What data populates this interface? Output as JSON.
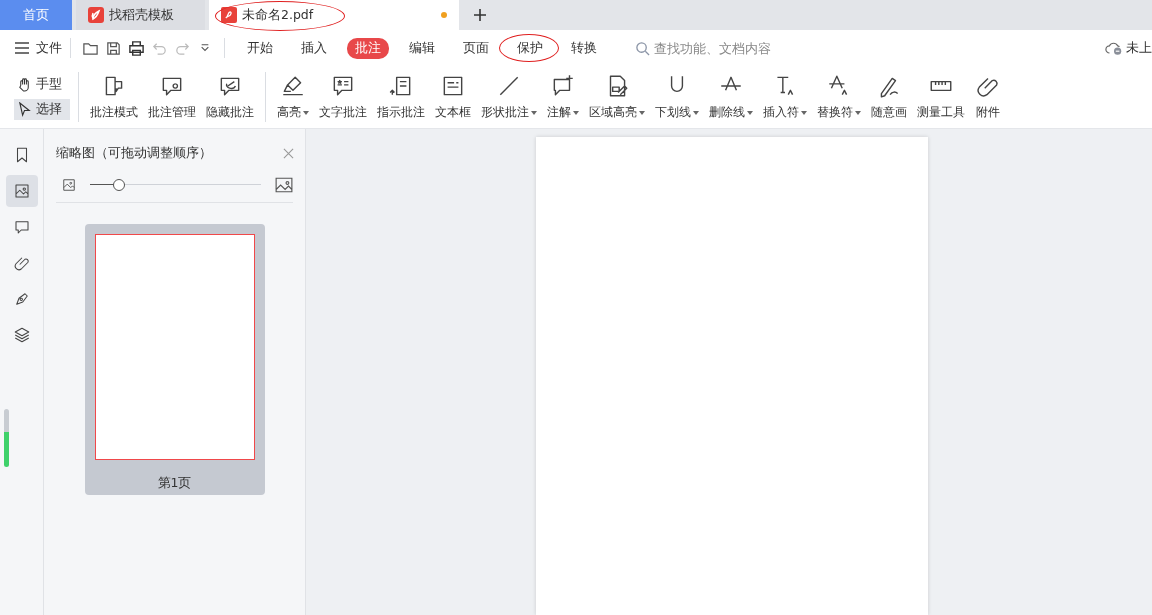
{
  "tabs": [
    {
      "label": "首页",
      "selected": false,
      "kind": "home"
    },
    {
      "label": "找稻壳模板",
      "selected": false,
      "kind": "template"
    },
    {
      "label": "未命名2.pdf",
      "selected": true,
      "kind": "pdf",
      "unsaved": true,
      "circled": true
    }
  ],
  "menu": {
    "label": "文件",
    "items": [
      {
        "label": "开始",
        "selected": false,
        "circled": false
      },
      {
        "label": "插入",
        "selected": false,
        "circled": false
      },
      {
        "label": "批注",
        "selected": true,
        "circled": false
      },
      {
        "label": "编辑",
        "selected": false,
        "circled": false
      },
      {
        "label": "页面",
        "selected": false,
        "circled": false
      },
      {
        "label": "保护",
        "selected": false,
        "circled": true
      },
      {
        "label": "转换",
        "selected": false,
        "circled": false
      }
    ]
  },
  "search": {
    "placeholder": "查找功能、文档内容"
  },
  "cloud_status": "未上",
  "modes": [
    {
      "label": "手型",
      "selected": false
    },
    {
      "label": "选择",
      "selected": true
    }
  ],
  "tool_groups": [
    [
      {
        "label": "批注模式",
        "dropdown": false
      },
      {
        "label": "批注管理",
        "dropdown": false
      },
      {
        "label": "隐藏批注",
        "dropdown": false
      }
    ],
    [
      {
        "label": "高亮",
        "dropdown": true
      },
      {
        "label": "文字批注",
        "dropdown": false
      },
      {
        "label": "指示批注",
        "dropdown": false
      },
      {
        "label": "文本框",
        "dropdown": false
      },
      {
        "label": "形状批注",
        "dropdown": true
      },
      {
        "label": "注解",
        "dropdown": true
      },
      {
        "label": "区域高亮",
        "dropdown": true
      },
      {
        "label": "下划线",
        "dropdown": true
      },
      {
        "label": "删除线",
        "dropdown": true
      },
      {
        "label": "插入符",
        "dropdown": true
      },
      {
        "label": "替换符",
        "dropdown": true
      },
      {
        "label": "随意画",
        "dropdown": false
      },
      {
        "label": "测量工具",
        "dropdown": false
      },
      {
        "label": "附件",
        "dropdown": false
      }
    ]
  ],
  "side_icons": [
    {
      "selected": false
    },
    {
      "selected": true
    },
    {
      "selected": false
    },
    {
      "selected": false
    },
    {
      "selected": false
    },
    {
      "selected": false
    }
  ],
  "thumbnails": {
    "title": "缩略图（可拖动调整顺序）",
    "zoom": {
      "level": 0.17
    },
    "pages": [
      {
        "label": "第1页",
        "selected": true
      }
    ]
  }
}
